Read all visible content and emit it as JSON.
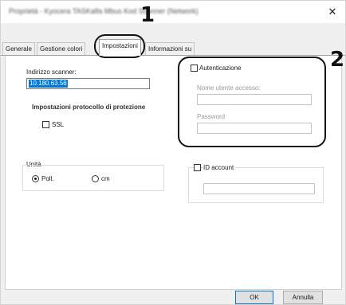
{
  "window": {
    "title": "Proprietà - Kyocera TASKalfa Mbus Kod Scanner (Network)",
    "close_glyph": "✕"
  },
  "tabs": [
    {
      "label": "Generale"
    },
    {
      "label": "Gestione colori"
    },
    {
      "label": "Impostazioni",
      "active": true
    },
    {
      "label": "Informazioni su"
    }
  ],
  "scanner": {
    "address_label": "Indirizzo scanner:",
    "address_value": "10.180.63.56"
  },
  "protection": {
    "group_label": "Impostazioni protocollo di protezione",
    "ssl_label": "SSL",
    "ssl_checked": false
  },
  "units": {
    "group_label": "Unità",
    "options": [
      {
        "label": "Poll.",
        "checked": true
      },
      {
        "label": "cm",
        "checked": false
      }
    ]
  },
  "auth": {
    "checkbox_label": "Autenticazione",
    "checked": false,
    "username_label": "Nome utente accesso:",
    "username_value": "",
    "password_label": "Password",
    "password_value": ""
  },
  "account": {
    "checkbox_label": "ID account",
    "checked": false,
    "value": ""
  },
  "callouts": {
    "one": "1",
    "two": "2"
  },
  "footer": {
    "ok_label": "OK",
    "cancel_label": "Annulla"
  }
}
